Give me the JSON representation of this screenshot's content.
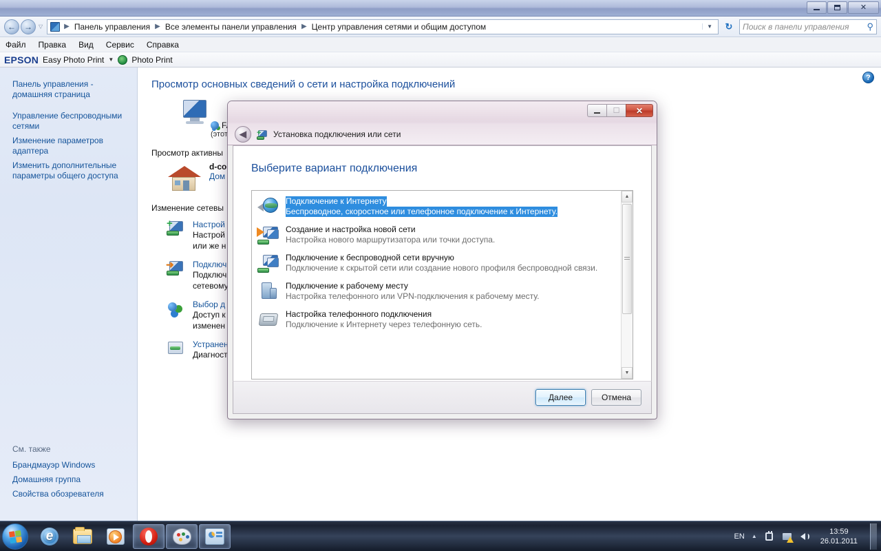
{
  "explorer": {
    "window_buttons": {
      "minimize": "minimize-icon",
      "maximize": "maximize-icon",
      "close": "✕"
    },
    "address": {
      "crumbs": [
        "Панель управления",
        "Все элементы панели управления",
        "Центр управления сетями и общим доступом"
      ],
      "separator": "▶",
      "dropdown": "▼",
      "refresh": "↻"
    },
    "search": {
      "placeholder": "Поиск в панели управления",
      "icon": "search-icon"
    },
    "menu": [
      "Файл",
      "Правка",
      "Вид",
      "Сервис",
      "Справка"
    ],
    "epson_toolbar": {
      "logo": "EPSON",
      "item1": "Easy Photo Print",
      "caret": "▼",
      "item2": "Photo Print"
    },
    "sidebar": {
      "items": [
        "Панель управления - домашняя страница",
        "Управление беспроводными сетями",
        "Изменение параметров адаптера",
        "Изменить дополнительные параметры общего доступа"
      ],
      "see_also_title": "См. также",
      "see_also": [
        "Брандмауэр Windows",
        "Домашняя группа",
        "Свойства обозревателя"
      ]
    },
    "content": {
      "help": "?",
      "title": "Просмотр основных сведений о сети и настройка подключений",
      "map_computer": "FARAONNB",
      "map_computer_sub": "(этот компьют",
      "active_heading": "Просмотр активны",
      "active_net_name": "d-co",
      "active_net_type": "Дом",
      "change_heading": "Изменение сетевы",
      "change_items": [
        {
          "title": "Настрой",
          "desc": "Настрой\nили же н"
        },
        {
          "title": "Подключ",
          "desc": "Подключ\nсетевому"
        },
        {
          "title": "Выбор д",
          "desc": "Доступ к\nизменен"
        },
        {
          "title": "Устранен",
          "desc": "Диагност"
        }
      ]
    }
  },
  "dialog": {
    "title": "Установка подключения или сети",
    "back": "◀",
    "window_buttons": {
      "minimize": "minimize-icon",
      "maximize": "maximize-icon",
      "close": "✕"
    },
    "heading": "Выберите вариант подключения",
    "options": [
      {
        "title": "Подключение к Интернету",
        "desc": "Беспроводное, скоростное или телефонное подключение к Интернету.",
        "icon": "globe-icon",
        "selected": true
      },
      {
        "title": "Создание и настройка новой сети",
        "desc": "Настройка нового маршрутизатора или точки доступа.",
        "icon": "new-network-icon",
        "selected": false
      },
      {
        "title": "Подключение к беспроводной сети вручную",
        "desc": "Подключение к скрытой сети или создание нового профиля беспроводной связи.",
        "icon": "wireless-manual-icon",
        "selected": false
      },
      {
        "title": "Подключение к рабочему месту",
        "desc": "Настройка телефонного или VPN-подключения к рабочему месту.",
        "icon": "workplace-icon",
        "selected": false
      },
      {
        "title": "Настройка телефонного подключения",
        "desc": "Подключение к Интернету через телефонную сеть.",
        "icon": "dialup-fax-icon",
        "selected": false
      }
    ],
    "scrollbar": {
      "up": "▲",
      "down": "▼"
    },
    "buttons": {
      "next": "Далее",
      "cancel": "Отмена"
    }
  },
  "taskbar": {
    "start": "start-orb",
    "items": [
      {
        "name": "internet-explorer",
        "active": false
      },
      {
        "name": "windows-explorer",
        "active": false
      },
      {
        "name": "windows-media-player",
        "active": false
      },
      {
        "name": "opera-browser",
        "active": true
      },
      {
        "name": "paint",
        "active": true
      },
      {
        "name": "control-panel-window",
        "active": true
      }
    ],
    "tray": {
      "language": "EN",
      "caret": "▲",
      "icons": [
        "removable-device-icon",
        "network-warning-icon",
        "volume-icon"
      ],
      "time": "13:59",
      "date": "26.01.2011"
    }
  },
  "colors": {
    "accent_blue": "#2e8ddf",
    "link_blue": "#14539a",
    "heading_blue": "#1b4f9c",
    "dialog_glass": "#e3d3e0",
    "close_red": "#cf5340"
  }
}
